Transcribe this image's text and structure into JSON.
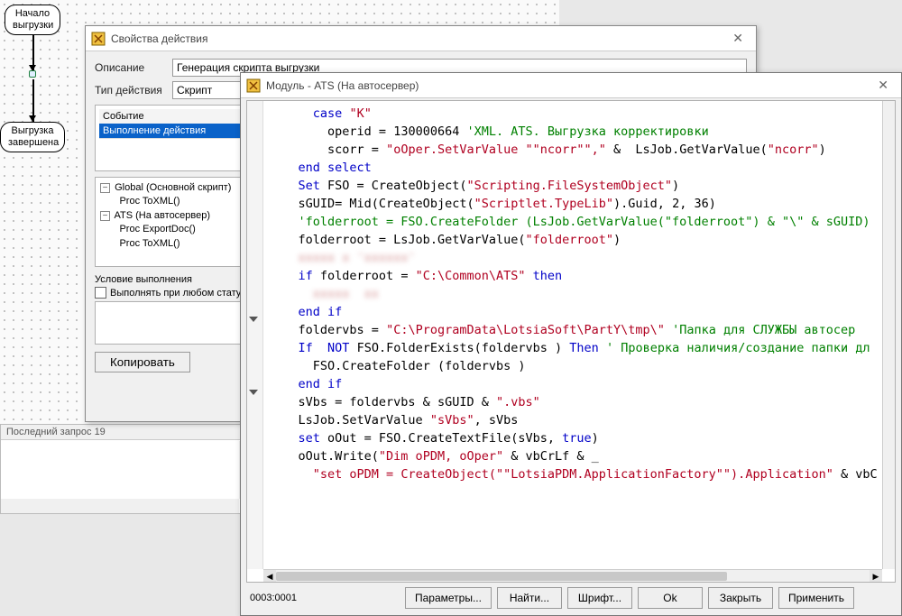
{
  "canvas": {
    "node_start_l1": "Начало",
    "node_start_l2": "выгрузки",
    "node_end_l1": "Выгрузка",
    "node_end_l2": "завершена"
  },
  "props_dialog": {
    "title": "Свойства действия",
    "lbl_desc": "Описание",
    "val_desc": "Генерация скрипта выгрузки",
    "lbl_type": "Тип действия",
    "val_type": "Скрипт",
    "event_hdr": "Событие",
    "event_sel": "Выполнение действия",
    "tree": {
      "n1": "Global (Основной скрипт)",
      "n1c1": "Proc ToXML()",
      "n2": "ATS (На автосервер)",
      "n2c1": "Proc ExportDoc()",
      "n2c2": "Proc ToXML()"
    },
    "cond_lbl": "Условие выполнения",
    "chk_lbl": "Выполнять при любом статусе",
    "btn_copy": "Копировать"
  },
  "module_dialog": {
    "title": "Модуль - ATS (На автосервер)",
    "cursor_pos": "0003:0001",
    "buttons": {
      "params": "Параметры...",
      "find": "Найти...",
      "font": "Шрифт...",
      "ok": "Ok",
      "close": "Закрыть",
      "apply": "Применить"
    },
    "code_lines": [
      {
        "indent": 3,
        "parts": [
          {
            "t": "kw",
            "v": "case"
          },
          {
            "t": "",
            "v": " "
          },
          {
            "t": "str",
            "v": "\"K\""
          }
        ]
      },
      {
        "indent": 4,
        "parts": [
          {
            "t": "",
            "v": "operid = "
          },
          {
            "t": "num",
            "v": "130000664"
          },
          {
            "t": "",
            "v": " "
          },
          {
            "t": "cmt",
            "v": "'XML. ATS. Выгрузка корректировки"
          }
        ]
      },
      {
        "indent": 4,
        "parts": [
          {
            "t": "",
            "v": "scorr = "
          },
          {
            "t": "str",
            "v": "\"oOper.SetVarValue \"\"ncorr\"\",\""
          },
          {
            "t": "",
            "v": " & "
          },
          {
            "t": "",
            "v": " LsJob.GetVarValue("
          },
          {
            "t": "str",
            "v": "\"ncorr\""
          },
          {
            "t": "",
            "v": ")"
          }
        ]
      },
      {
        "indent": 2,
        "parts": [
          {
            "t": "kw",
            "v": "end select"
          }
        ]
      },
      {
        "indent": 0,
        "parts": [
          {
            "t": "",
            "v": ""
          }
        ]
      },
      {
        "indent": 2,
        "parts": [
          {
            "t": "kw",
            "v": "Set"
          },
          {
            "t": "",
            "v": " FSO = CreateObject("
          },
          {
            "t": "str",
            "v": "\"Scripting.FileSystemObject\""
          },
          {
            "t": "",
            "v": ")"
          }
        ]
      },
      {
        "indent": 2,
        "parts": [
          {
            "t": "",
            "v": "sGUID= Mid(CreateObject("
          },
          {
            "t": "str",
            "v": "\"Scriptlet.TypeLib\""
          },
          {
            "t": "",
            "v": ").Guid, "
          },
          {
            "t": "num",
            "v": "2"
          },
          {
            "t": "",
            "v": ", "
          },
          {
            "t": "num",
            "v": "36"
          },
          {
            "t": "",
            "v": ")"
          }
        ]
      },
      {
        "indent": 2,
        "parts": [
          {
            "t": "cmt",
            "v": "'folderroot = FSO.CreateFolder (LsJob.GetVarValue(\"folderroot\") & \"\\\" & sGUID)"
          }
        ]
      },
      {
        "indent": 2,
        "parts": [
          {
            "t": "",
            "v": "folderroot = LsJob.GetVarValue("
          },
          {
            "t": "str",
            "v": "\"folderroot\""
          },
          {
            "t": "",
            "v": ")"
          }
        ]
      },
      {
        "indent": 2,
        "parts": [
          {
            "t": "blur",
            "v": "xxxxx x 'xxxxxx'"
          }
        ]
      },
      {
        "indent": 2,
        "parts": [
          {
            "t": "kw",
            "v": "if"
          },
          {
            "t": "",
            "v": " folderroot = "
          },
          {
            "t": "str",
            "v": "\"C:\\Common\\ATS\""
          },
          {
            "t": "",
            "v": " "
          },
          {
            "t": "kw",
            "v": "then"
          }
        ]
      },
      {
        "indent": 3,
        "parts": [
          {
            "t": "blur",
            "v": "xxxxx  xx"
          }
        ]
      },
      {
        "indent": 2,
        "parts": [
          {
            "t": "kw",
            "v": "end if"
          }
        ]
      },
      {
        "indent": 2,
        "parts": [
          {
            "t": "",
            "v": "foldervbs = "
          },
          {
            "t": "str",
            "v": "\"C:\\ProgramData\\LotsiaSoft\\PartY\\tmp\\\""
          },
          {
            "t": "",
            "v": " "
          },
          {
            "t": "cmt",
            "v": "'Папка для СЛУЖБЫ автосер"
          }
        ]
      },
      {
        "indent": 2,
        "parts": [
          {
            "t": "kw",
            "v": "If"
          },
          {
            "t": "",
            "v": "  "
          },
          {
            "t": "kw",
            "v": "NOT"
          },
          {
            "t": "",
            "v": " FSO.FolderExists(foldervbs ) "
          },
          {
            "t": "kw",
            "v": "Then"
          },
          {
            "t": "",
            "v": " "
          },
          {
            "t": "cmt",
            "v": "' Проверка наличия/создание папки дл"
          }
        ]
      },
      {
        "indent": 3,
        "parts": [
          {
            "t": "",
            "v": "FSO.CreateFolder (foldervbs )"
          }
        ]
      },
      {
        "indent": 2,
        "parts": [
          {
            "t": "kw",
            "v": "end if"
          }
        ]
      },
      {
        "indent": 2,
        "parts": [
          {
            "t": "",
            "v": "sVbs = foldervbs & sGUID & "
          },
          {
            "t": "str",
            "v": "\".vbs\""
          }
        ]
      },
      {
        "indent": 2,
        "parts": [
          {
            "t": "",
            "v": "LsJob.SetVarValue "
          },
          {
            "t": "str",
            "v": "\"sVbs\""
          },
          {
            "t": "",
            "v": ", sVbs"
          }
        ]
      },
      {
        "indent": 2,
        "parts": [
          {
            "t": "kw",
            "v": "set"
          },
          {
            "t": "",
            "v": " oOut = FSO.CreateTextFile(sVbs, "
          },
          {
            "t": "kw",
            "v": "true"
          },
          {
            "t": "",
            "v": ")"
          }
        ]
      },
      {
        "indent": 2,
        "parts": [
          {
            "t": "",
            "v": "oOut.Write("
          },
          {
            "t": "str",
            "v": "\"Dim oPDM, oOper\""
          },
          {
            "t": "",
            "v": " & vbCrLf & _"
          }
        ]
      },
      {
        "indent": 3,
        "parts": [
          {
            "t": "str",
            "v": "\"set oPDM = CreateObject(\"\"LotsiaPDM.ApplicationFactory\"\").Application\""
          },
          {
            "t": "",
            "v": " & vbC"
          }
        ]
      }
    ]
  },
  "bottom_panel": {
    "hdr": "Последний запрос 19"
  }
}
